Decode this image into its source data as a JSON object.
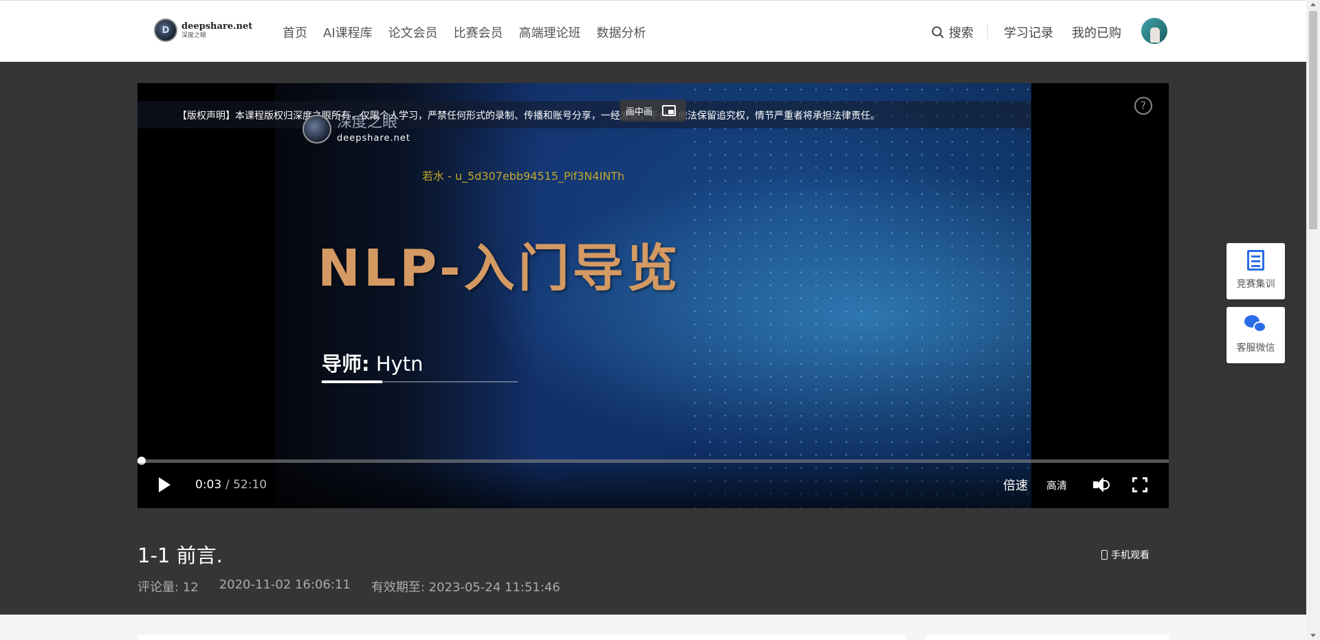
{
  "header": {
    "logo": {
      "name": "deepshare.net",
      "subtitle": "深度之眼",
      "mark": "D"
    },
    "nav": [
      "首页",
      "AI课程库",
      "论文会员",
      "比赛会员",
      "高端理论班",
      "数据分析"
    ],
    "search_label": "搜索",
    "study_record": "学习记录",
    "my_purchases": "我的已购"
  },
  "player": {
    "copyright_notice": "【版权声明】本课程版权归深度之眼所有，仅限个人学习，严禁任何形式的录制、传播和账号分享，一经发现，平台将依法保留追究权，情节严重者将承担法律责任。",
    "pip_label": "画中画",
    "video_logo_cn": "深度之眼",
    "video_logo_en": "deepshare.net",
    "watermark": "若水 - u_5d307ebb94515_Pif3N4INTh",
    "video_title": "NLP-入门导览",
    "mentor_label": "导师:",
    "mentor_name": "Hytn",
    "current_time": "0:03",
    "total_time": "/ 52:10",
    "progress": 0.001,
    "speed_label": "倍速",
    "quality_label": "高清",
    "icons": [
      "play-icon",
      "volume-icon",
      "fullscreen-icon",
      "help-icon",
      "pip-icon"
    ]
  },
  "lesson": {
    "title": "1-1 前言.",
    "mobile_watch": "手机观看",
    "comments": "评论量: 12",
    "date": "2020-11-02 16:06:11",
    "expiry": "有效期至:  2023-05-24 11:51:46"
  },
  "floating": {
    "competition_training": "竞赛集训",
    "service_wechat": "客服微信"
  },
  "colors": {
    "dark_bg": "#353535",
    "video_title": "#d59a63",
    "watermark": "#c3a72a",
    "accent": "#2b6ce8"
  }
}
